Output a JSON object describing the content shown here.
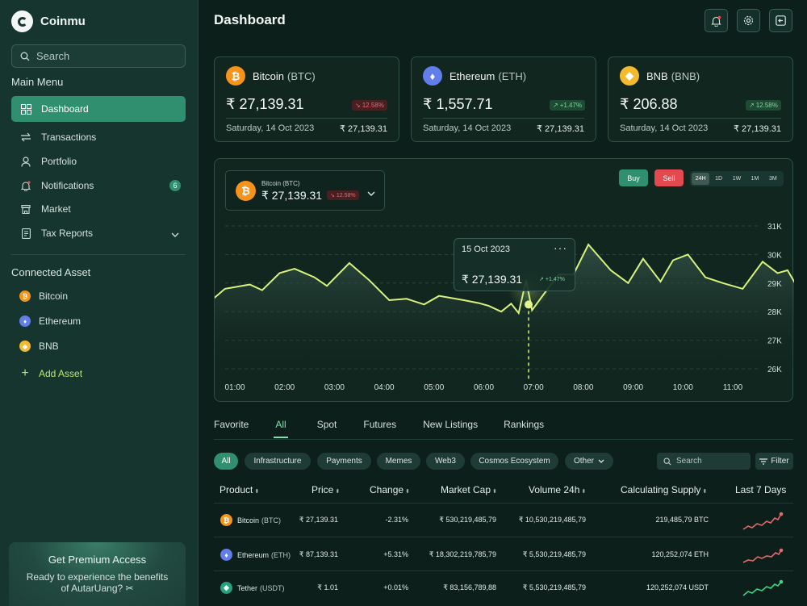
{
  "app": {
    "name": "Coinmu"
  },
  "sidebar": {
    "search_placeholder": "Search",
    "main_menu_title": "Main Menu",
    "menu": [
      {
        "label": "Dashboard",
        "icon": "grid-icon",
        "active": true
      },
      {
        "label": "Transactions",
        "icon": "transfer-icon"
      },
      {
        "label": "Portfolio",
        "icon": "user-icon"
      },
      {
        "label": "Notifications",
        "icon": "bell-icon",
        "badge": "6"
      },
      {
        "label": "Market",
        "icon": "store-icon"
      },
      {
        "label": "Tax Reports",
        "icon": "document-icon"
      }
    ],
    "connected_title": "Connected Asset",
    "assets": [
      {
        "label": "Bitcoin",
        "color": "#f7931a"
      },
      {
        "label": "Ethereum",
        "color": "#627eea"
      },
      {
        "label": "BNB",
        "color": "#f3ba2f"
      }
    ],
    "add_asset_label": "Add Asset",
    "premium": {
      "title": "Get Premium Access",
      "text_line1": "Ready to experience the benefits",
      "text_line2": "of AutarUang? ✂"
    }
  },
  "header": {
    "title": "Dashboard"
  },
  "cards": [
    {
      "name": "Bitcoin",
      "ticker": "(BTC)",
      "price": "₹ 27,139.31",
      "change": "12.58%",
      "direction": "down",
      "date": "Saturday, 14 Oct 2023",
      "value": "₹ 27,139.31",
      "color": "#f7931a"
    },
    {
      "name": "Ethereum",
      "ticker": "(ETH)",
      "price": "₹ 1,557.71",
      "change": "+1.47%",
      "direction": "up",
      "date": "Saturday, 14 Oct 2023",
      "value": "₹ 27,139.31",
      "color": "#627eea"
    },
    {
      "name": "BNB",
      "ticker": "(BNB)",
      "price": "₹ 206.88",
      "change": "12.58%",
      "direction": "up",
      "date": "Saturday, 14 Oct 2023",
      "value": "₹ 27,139.31",
      "color": "#f3ba2f"
    }
  ],
  "chart_panel": {
    "selected_coin": "Bitcoin (BTC)",
    "selected_price": "₹ 27,139.31",
    "selected_change": "12.58%",
    "buy_label": "Buy",
    "sell_label": "Sell",
    "ranges": [
      "24H",
      "1D",
      "1W",
      "1M",
      "3M"
    ],
    "active_range": "24H",
    "tooltip": {
      "date": "15 Oct 2023",
      "price": "₹ 27,139.31",
      "change": "+1.47%"
    }
  },
  "chart_data": {
    "type": "area",
    "x_labels": [
      "01:00",
      "02:00",
      "03:00",
      "04:00",
      "05:00",
      "06:00",
      "07:00",
      "08:00",
      "09:00",
      "10:00",
      "11:00"
    ],
    "y_ticks": [
      "31K",
      "30K",
      "29K",
      "28K",
      "27K",
      "26K"
    ],
    "ylim": [
      26000,
      31000
    ],
    "grid": true,
    "points": [
      [
        0.5,
        28350
      ],
      [
        0.8,
        28800
      ],
      [
        1.3,
        28950
      ],
      [
        1.55,
        28750
      ],
      [
        1.9,
        29350
      ],
      [
        2.2,
        29500
      ],
      [
        2.6,
        29200
      ],
      [
        2.85,
        28900
      ],
      [
        3.3,
        29700
      ],
      [
        3.7,
        29100
      ],
      [
        4.1,
        28400
      ],
      [
        4.45,
        28450
      ],
      [
        4.8,
        28250
      ],
      [
        5.1,
        28550
      ],
      [
        5.6,
        28400
      ],
      [
        5.9,
        28300
      ],
      [
        6.1,
        28200
      ],
      [
        6.35,
        28000
      ],
      [
        6.55,
        28280
      ],
      [
        6.7,
        27950
      ],
      [
        6.85,
        29100
      ],
      [
        6.97,
        28050
      ],
      [
        7.2,
        28600
      ],
      [
        7.5,
        29300
      ],
      [
        7.8,
        29300
      ],
      [
        8.1,
        30350
      ],
      [
        8.55,
        29450
      ],
      [
        8.9,
        29000
      ],
      [
        9.2,
        29850
      ],
      [
        9.55,
        29050
      ],
      [
        9.8,
        29800
      ],
      [
        10.1,
        30000
      ],
      [
        10.45,
        29200
      ],
      [
        10.8,
        29000
      ],
      [
        11.2,
        28800
      ],
      [
        11.6,
        29750
      ],
      [
        11.9,
        29350
      ],
      [
        12.1,
        29450
      ],
      [
        12.35,
        28700
      ],
      [
        12.45,
        28900
      ],
      [
        12.55,
        28600
      ]
    ],
    "highlight": {
      "x": 6.9,
      "y": 28250
    }
  },
  "tabs": [
    "Favorite",
    "All",
    "Spot",
    "Futures",
    "New Listings",
    "Rankings"
  ],
  "active_tab": "All",
  "chips": [
    "All",
    "Infrastructure",
    "Payments",
    "Memes",
    "Web3",
    "Cosmos Ecosystem",
    "Other"
  ],
  "table_search_placeholder": "Search",
  "filter_label": "Filter",
  "table": {
    "headers": [
      "Product",
      "Price",
      "Change",
      "Market Cap",
      "Volume 24h",
      "Calculating Supply",
      "Last 7 Days"
    ],
    "rows": [
      {
        "name": "Bitcoin",
        "ticker": "(BTC)",
        "price": "₹ 27,139.31",
        "change": "-2.31%",
        "market_cap": "₹ 530,219,485,79",
        "volume": "₹ 10,530,219,485,79",
        "supply": "219,485,79 BTC",
        "trend": "down",
        "color": "#f7931a"
      },
      {
        "name": "Ethereum",
        "ticker": "(ETH)",
        "price": "₹ 87,139.31",
        "change": "+5.31%",
        "market_cap": "₹ 18,302,219,785,79",
        "volume": "₹ 5,530,219,485,79",
        "supply": "120,252,074 ETH",
        "trend": "down",
        "color": "#627eea"
      },
      {
        "name": "Tether",
        "ticker": "(USDT)",
        "price": "₹ 1.01",
        "change": "+0.01%",
        "market_cap": "₹ 83,156,789,88",
        "volume": "₹ 5,530,219,485,79",
        "supply": "120,252,074 USDT",
        "trend": "up",
        "color": "#26a17b"
      }
    ]
  }
}
